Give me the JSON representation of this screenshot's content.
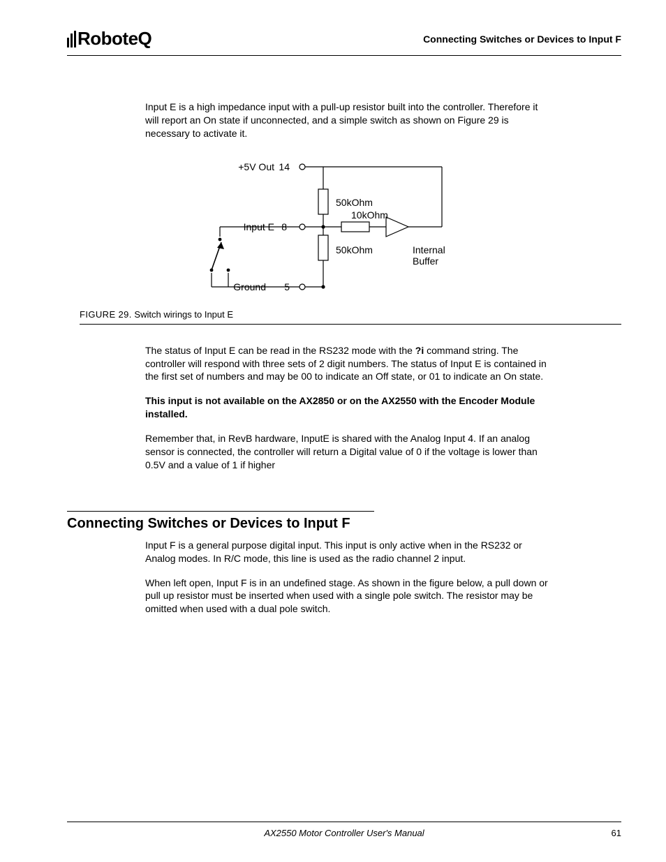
{
  "header": {
    "logo_text": "RoboteQ",
    "title": "Connecting Switches or Devices to Input F"
  },
  "intro_para": "Input E is a high impedance input with a pull-up resistor built into the controller. Therefore it will report an On state if unconnected, and a simple switch as shown on Figure 29 is necessary to activate it.",
  "figure": {
    "caption_prefix": "FIGURE 29.",
    "caption_text": "Switch wirings to Input E",
    "labels": {
      "v5out": "+5V Out",
      "pin14": "14",
      "inputE": "Input E",
      "pin8": "8",
      "ground": "Ground",
      "pin5": "5",
      "r50k_top": "50kOhm",
      "r10k": "10kOhm",
      "r50k_bottom": "50kOhm",
      "buffer1": "Internal",
      "buffer2": "Buffer"
    }
  },
  "para_status_1": "The status of Input E can be read in the RS232 mode with the ",
  "para_status_cmd": "?i",
  "para_status_2": " command string. The controller will respond with three sets of 2 digit numbers. The status of Input E is contained in the first set of numbers and may be 00 to indicate an Off state, or 01 to indicate an On state.",
  "para_bold_note": "This input is not available on the AX2850 or on the AX2550 with the Encoder Module installed.",
  "para_revb": "Remember that, in RevB hardware, InputE is shared with the Analog Input 4. If an analog sensor is connected, the controller will return a Digital value of 0 if the voltage is lower than 0.5V and a value of 1 if higher",
  "section_heading": "Connecting Switches or Devices to Input F",
  "para_f1": "Input F is a general purpose digital input. This input is only active when in the RS232 or Analog modes. In R/C mode, this line is used as the radio channel 2 input.",
  "para_f2": "When left open, Input F is in an undefined stage. As shown in the figure below, a pull down or pull up resistor must be inserted when used with a single pole switch. The resistor may be omitted when used with a dual pole switch.",
  "footer": {
    "manual_title": "AX2550 Motor Controller User's Manual",
    "page": "61"
  }
}
